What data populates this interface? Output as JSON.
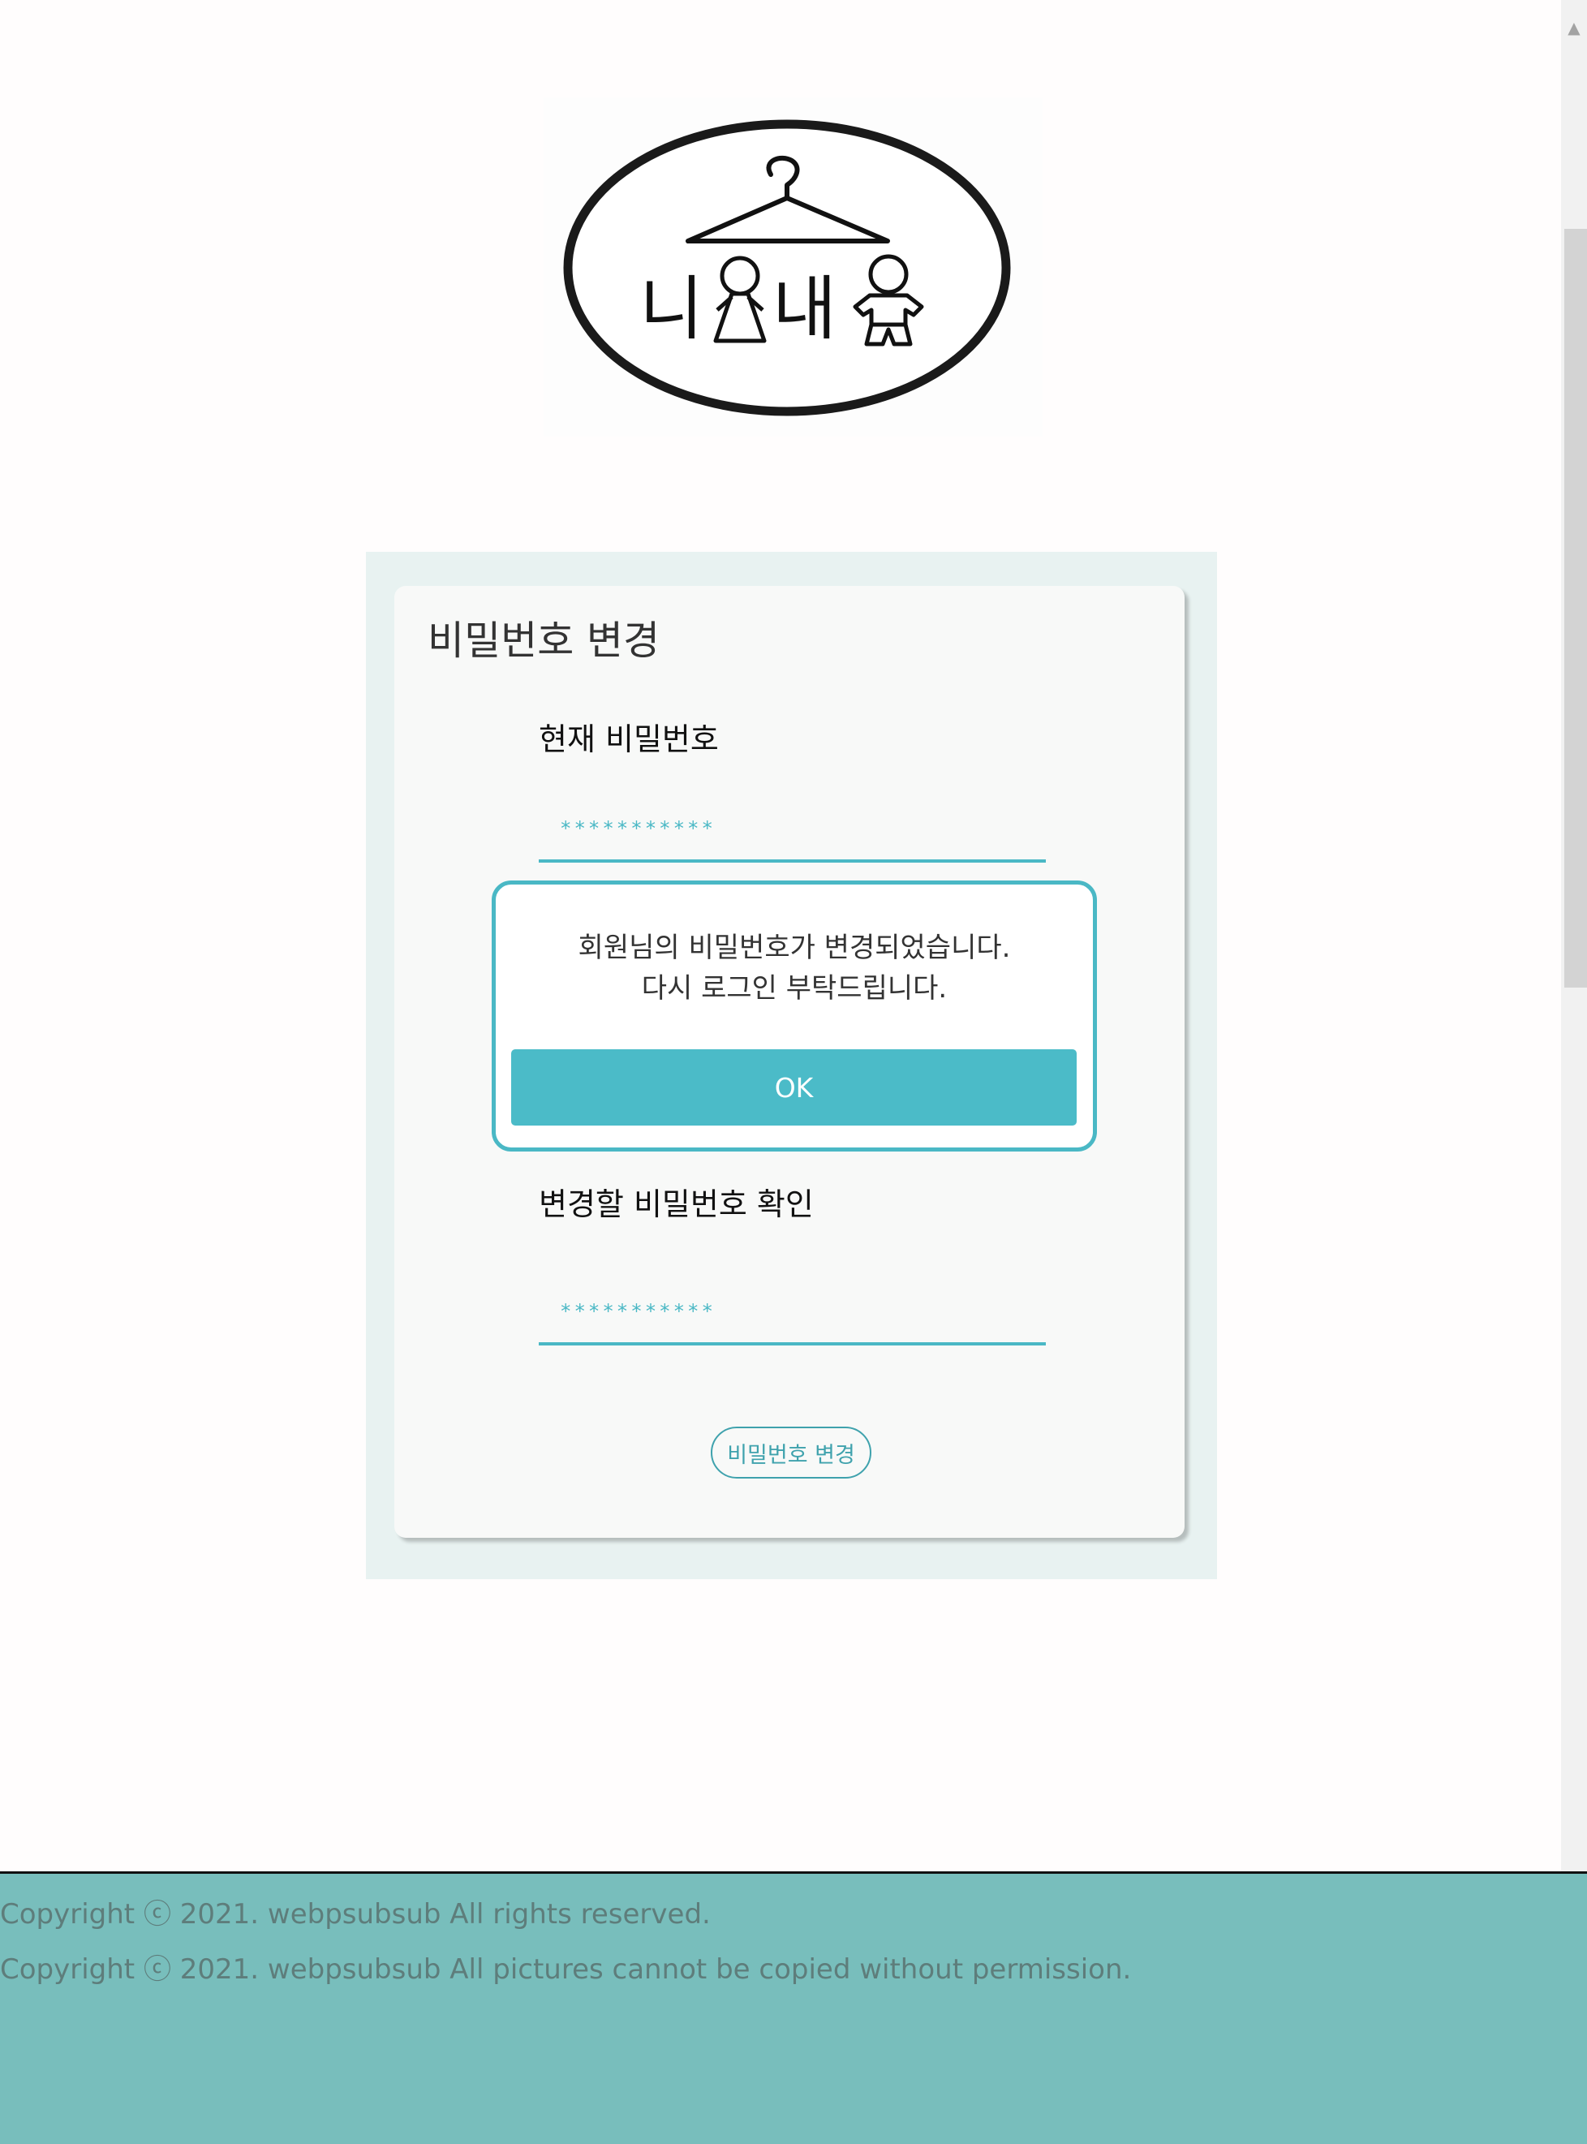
{
  "logo": {
    "text_part1": "니",
    "text_part2": "내"
  },
  "page": {
    "title": "비밀번호 변경"
  },
  "fields": {
    "current_label": "현재 비밀번호",
    "current_value": "***********",
    "confirm_label": "변경할 비밀번호 확인",
    "confirm_value": "***********"
  },
  "submit_label": "비밀번호 변경",
  "modal": {
    "message_line1": "회원님의 비밀번호가 변경되었습니다.",
    "message_line2": "다시 로그인 부탁드립니다.",
    "ok_label": "OK"
  },
  "footer": {
    "line1": "Copyright ⓒ 2021. webpsubsub  All rights reserved.",
    "line2": "Copyright ⓒ 2021. webpsubsub  All pictures cannot be copied without permission."
  },
  "colors": {
    "accent": "#4bbbc8",
    "footer_bg": "#78bebc",
    "panel_bg": "#e8f2f1"
  }
}
